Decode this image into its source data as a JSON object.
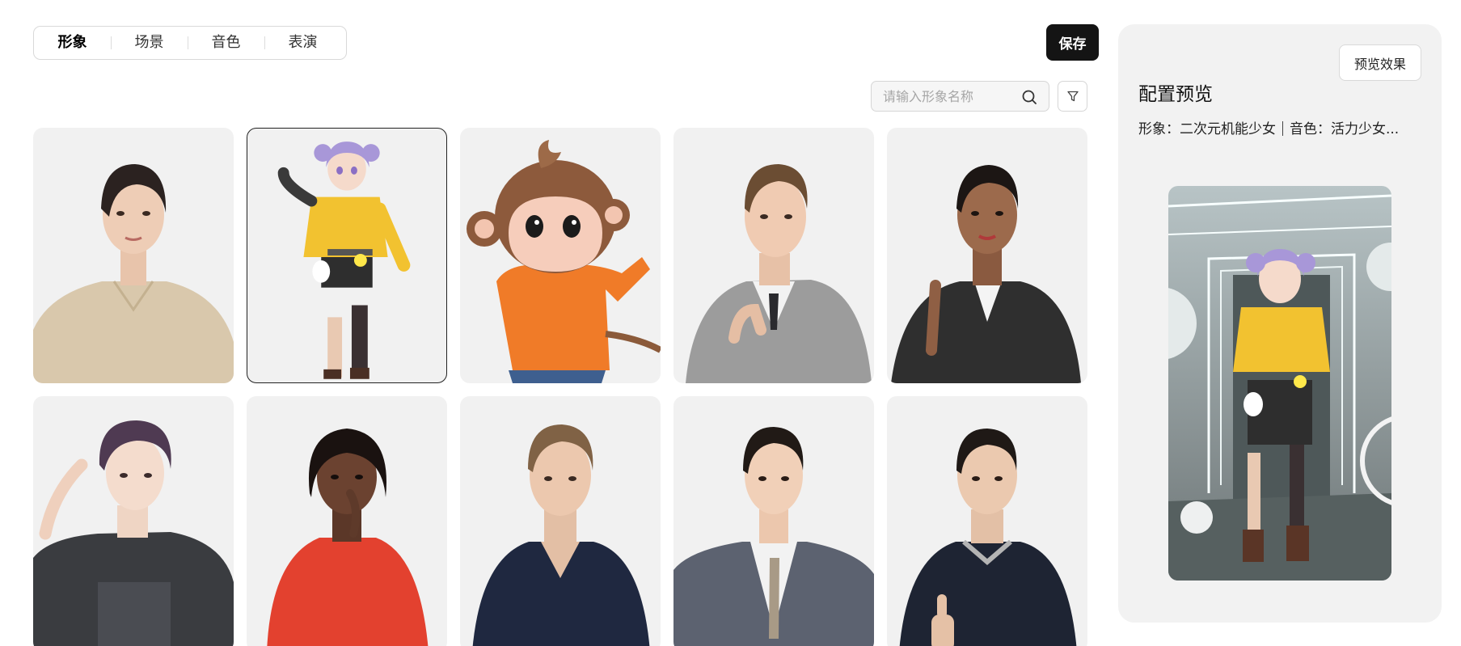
{
  "tabs": [
    {
      "label": "形象",
      "active": true
    },
    {
      "label": "场景",
      "active": false
    },
    {
      "label": "音色",
      "active": false
    },
    {
      "label": "表演",
      "active": false
    }
  ],
  "toolbar": {
    "save_label": "保存"
  },
  "search": {
    "placeholder": "请输入形象名称",
    "value": "",
    "icon": "search-icon"
  },
  "filter": {
    "icon": "filter-icon"
  },
  "avatars": [
    {
      "id": "avatar-1",
      "desc": "woman-beige-sweater",
      "selected": false
    },
    {
      "id": "avatar-2",
      "desc": "anime-girl-yellow-jacket",
      "selected": true
    },
    {
      "id": "avatar-3",
      "desc": "cartoon-monkey-orange-shirt",
      "selected": false
    },
    {
      "id": "avatar-4",
      "desc": "man-grey-suit",
      "selected": false
    },
    {
      "id": "avatar-5",
      "desc": "woman-black-leather-jacket",
      "selected": false
    },
    {
      "id": "avatar-6",
      "desc": "young-man-purple-hair",
      "selected": false
    },
    {
      "id": "avatar-7",
      "desc": "woman-red-top",
      "selected": false
    },
    {
      "id": "avatar-8",
      "desc": "man-navy-polo",
      "selected": false
    },
    {
      "id": "avatar-9",
      "desc": "man-striped-suit",
      "selected": false
    },
    {
      "id": "avatar-10",
      "desc": "man-navy-polo-thumbs-up",
      "selected": false
    }
  ],
  "preview": {
    "button_label": "预览效果",
    "title": "配置预览",
    "avatar_label": "形象：二次元机能少女",
    "voice_label": "音色：活力少女..."
  }
}
